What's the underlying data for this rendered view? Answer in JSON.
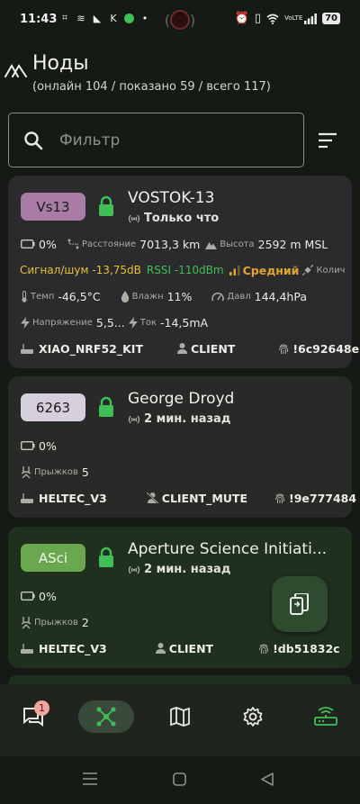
{
  "status_bar": {
    "time": "11:43",
    "battery": "70",
    "network": "VoLTE"
  },
  "header": {
    "title": "Ноды",
    "subtitle": "(онлайн 104 / показано 59 / всего 117)"
  },
  "search": {
    "placeholder": "Фильтр"
  },
  "nodes": [
    {
      "short": "Vs13",
      "name": "VOSTOK-13",
      "last_seen": "Только что",
      "battery": "0%",
      "distance_label": "Расстояние",
      "distance": "7013,3 km",
      "altitude_label": "Высота",
      "altitude": "2592 m MSL",
      "snr": "Сигнал/шум -13,75dB",
      "rssi": "RSSI -110dBm",
      "quality": "Средний",
      "sats_label": "Колич",
      "temp_label": "Темп",
      "temp": "-46,5°C",
      "humidity_label": "Влажн",
      "humidity": "11%",
      "pressure_label": "Давл",
      "pressure": "144,4hPa",
      "voltage_label": "Напряжение",
      "voltage": "5,5...",
      "current_label": "Ток",
      "current": "-14,5mA",
      "hardware": "XIAO_NRF52_KIT",
      "role": "CLIENT",
      "node_id": "!6c92648e",
      "badge_color": "#a87ca5"
    },
    {
      "short": "6263",
      "name": "George Droyd",
      "last_seen": "2 мин. назад",
      "battery": "0%",
      "jumps_label": "Прыжков",
      "jumps": "5",
      "hardware": "HELTEC_V3",
      "role": "CLIENT_MUTE",
      "node_id": "!9e777484",
      "badge_color": "#d6d0dc"
    },
    {
      "short": "ASci",
      "name": "Aperture Science Initiati...",
      "last_seen": "2 мин. назад",
      "battery": "0%",
      "jumps_label": "Прыжков",
      "jumps": "2",
      "hardware": "HELTEC_V3",
      "role": "CLIENT",
      "node_id": "!db51832c",
      "badge_color": "#6aa84f"
    }
  ],
  "bottom_nav": {
    "chat_badge": "1",
    "items": [
      "chat",
      "nodes",
      "map",
      "settings",
      "connections"
    ]
  },
  "colors": {
    "accent_green": "#3fbf56",
    "warning_yellow": "#e5c23a",
    "card1_bg": "#2b2a2c",
    "card2_bg": "#282a27",
    "card3_bg": "#20301f"
  }
}
